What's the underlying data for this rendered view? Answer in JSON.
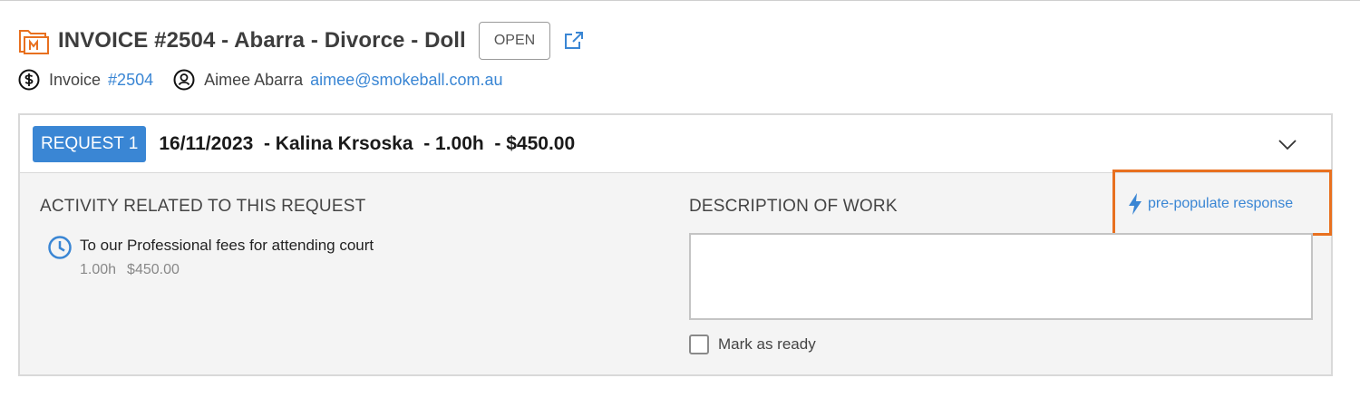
{
  "header": {
    "title": "INVOICE #2504 - Abarra - Divorce - Doll",
    "status": "OPEN",
    "matter_icon": "matter-folder-icon",
    "external_icon": "external-link-icon"
  },
  "subheader": {
    "invoice_label": "Invoice",
    "invoice_number": "#2504",
    "contact_name": "Aimee Abarra",
    "contact_email": "aimee@smokeball.com.au"
  },
  "request": {
    "badge": "REQUEST 1",
    "summary": "16/11/2023  - Kalina Krsoska  - 1.00h  - $450.00",
    "activity_heading": "ACTIVITY RELATED TO THIS REQUEST",
    "activities": [
      {
        "description": "To our Professional fees for attending court",
        "hours": "1.00h",
        "amount": "$450.00"
      }
    ],
    "description_heading": "DESCRIPTION OF WORK",
    "prepopulate_label": "pre-populate response",
    "description_value": "",
    "mark_ready_label": "Mark as ready"
  },
  "colors": {
    "accent": "#3a86d4",
    "highlight": "#e8701f",
    "matter_icon": "#e8701f"
  }
}
